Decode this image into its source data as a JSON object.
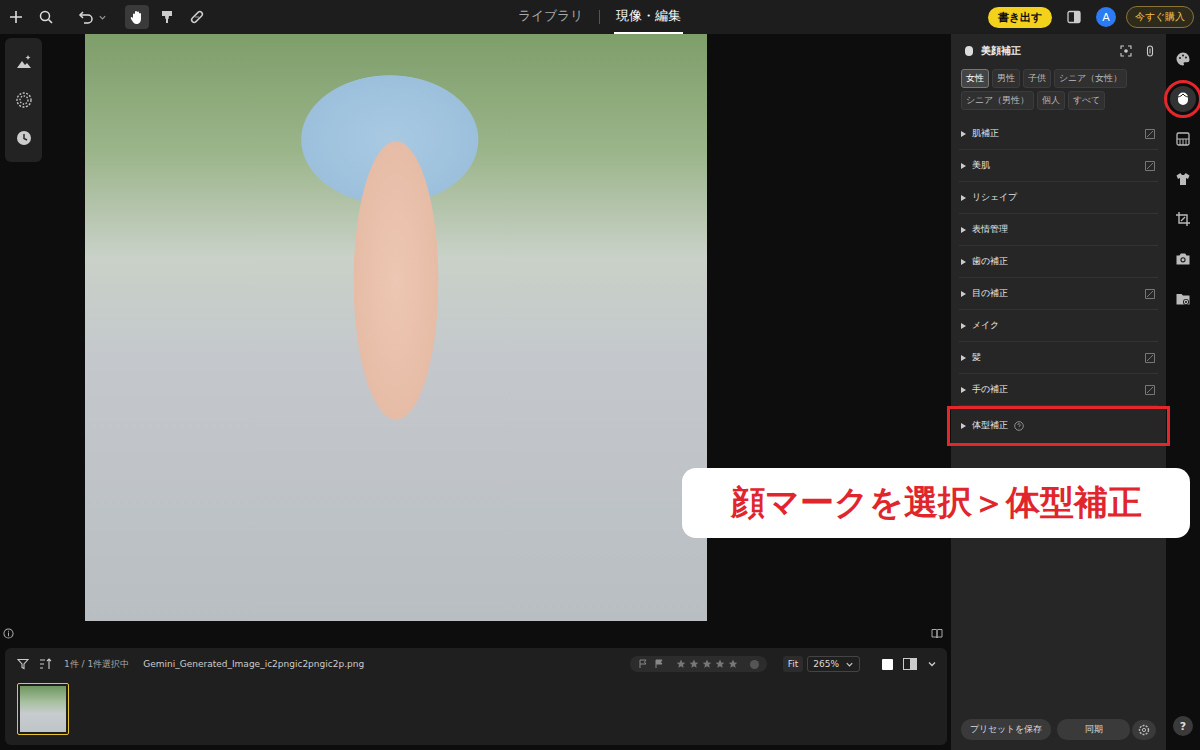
{
  "topbar": {
    "tools": [
      {
        "kind": "add",
        "selected": false
      },
      {
        "kind": "search",
        "selected": false
      },
      {
        "kind": "undo",
        "selected": false
      },
      {
        "kind": "hand",
        "selected": true
      },
      {
        "kind": "brush",
        "selected": false
      },
      {
        "kind": "heal",
        "selected": false
      }
    ],
    "tabs": [
      {
        "label": "ライブラリ",
        "selected": false
      },
      {
        "label": "現像・編集",
        "selected": true
      }
    ],
    "export_button": "書き出す",
    "avatar": "A",
    "buy_button": "今すぐ購入"
  },
  "left_tools": [
    {
      "kind": "ai"
    },
    {
      "kind": "grain"
    },
    {
      "kind": "history"
    }
  ],
  "panel": {
    "title": "美顔補正",
    "tags": [
      {
        "label": "女性",
        "selected": true
      },
      {
        "label": "男性",
        "selected": false
      },
      {
        "label": "子供",
        "selected": false
      },
      {
        "label": "シニア（女性）",
        "selected": false
      },
      {
        "label": "シニア（男性）",
        "selected": false
      },
      {
        "label": "個人",
        "selected": false
      },
      {
        "label": "すべて",
        "selected": false
      }
    ],
    "sections": [
      {
        "label": "肌補正",
        "expanded": false,
        "eraser": true,
        "help": false,
        "annotated": false
      },
      {
        "label": "美肌",
        "expanded": false,
        "eraser": true,
        "help": false,
        "annotated": false
      },
      {
        "label": "リシェイプ",
        "expanded": false,
        "eraser": false,
        "help": false,
        "annotated": false
      },
      {
        "label": "表情管理",
        "expanded": false,
        "eraser": false,
        "help": false,
        "annotated": false
      },
      {
        "label": "歯の補正",
        "expanded": false,
        "eraser": false,
        "help": false,
        "annotated": false
      },
      {
        "label": "目の補正",
        "expanded": false,
        "eraser": true,
        "help": false,
        "annotated": false
      },
      {
        "label": "メイク",
        "expanded": false,
        "eraser": false,
        "help": false,
        "annotated": false
      },
      {
        "label": "髪",
        "expanded": false,
        "eraser": true,
        "help": false,
        "annotated": false
      },
      {
        "label": "手の補正",
        "expanded": false,
        "eraser": true,
        "help": false,
        "annotated": false
      },
      {
        "label": "体型補正",
        "expanded": false,
        "eraser": false,
        "help": true,
        "annotated": true
      }
    ],
    "save_preset": "プリセットを保存",
    "sync": "同期"
  },
  "side_icons": [
    {
      "kind": "palette",
      "selected": false,
      "annotated": false
    },
    {
      "kind": "face",
      "selected": true,
      "annotated": true
    },
    {
      "kind": "gradient",
      "selected": false,
      "annotated": false
    },
    {
      "kind": "shirt",
      "selected": false,
      "annotated": false
    },
    {
      "kind": "crop",
      "selected": false,
      "annotated": false
    },
    {
      "kind": "camera",
      "selected": false,
      "annotated": false
    },
    {
      "kind": "folder",
      "selected": false,
      "annotated": false
    }
  ],
  "help": "?",
  "filmstrip": {
    "count": "1件 / 1件選択中",
    "filename": "Gemini_Generated_Image_ic2pngic2pngic2p.png",
    "stars": 0,
    "fit": "Fit",
    "zoom": "265%",
    "thumbnails": [
      {
        "selected": true
      }
    ]
  },
  "annotation": {
    "text": "顔マークを選択＞体型補正"
  }
}
